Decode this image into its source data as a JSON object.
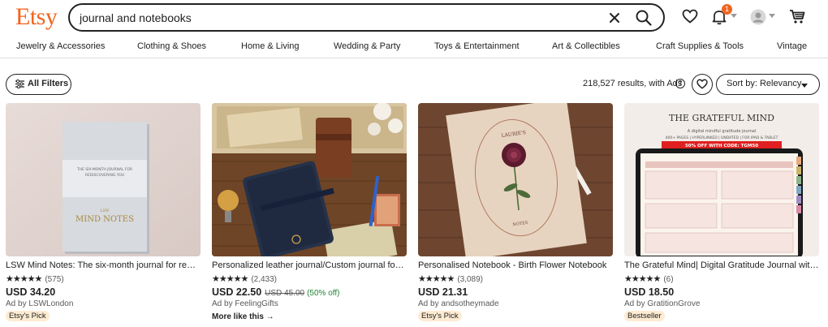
{
  "header": {
    "logo": "Etsy",
    "search_value": "journal and notebooks",
    "notification_count": "1"
  },
  "categories": [
    "Jewelry & Accessories",
    "Clothing & Shoes",
    "Home & Living",
    "Wedding & Party",
    "Toys & Entertainment",
    "Art & Collectibles",
    "Craft Supplies & Tools",
    "Vintage"
  ],
  "toolbar": {
    "filters_label": "All Filters",
    "results_text": "218,527 results, with Ads",
    "sort_label": "Sort by: Relevancy"
  },
  "products": [
    {
      "title": "LSW Mind Notes: The six-month journal for rediscovering you",
      "stars": "★★★★★",
      "reviews": "(575)",
      "price": "USD 34.20",
      "original_price": "",
      "discount": "",
      "seller": "Ad by LSWLondon",
      "badge": "Etsy's Pick",
      "more": ""
    },
    {
      "title": "Personalized leather journal/Custom journal for men",
      "stars": "★★★★★",
      "reviews": "(2,433)",
      "price": "USD 22.50",
      "original_price": "USD 45.00",
      "discount": "(50% off)",
      "seller": "Ad by FeelingGifts",
      "badge": "",
      "more": "More like this →"
    },
    {
      "title": "Personalised Notebook - Birth Flower Notebook",
      "stars": "★★★★★",
      "reviews": "(3,089)",
      "price": "USD 21.31",
      "original_price": "",
      "discount": "",
      "seller": "Ad by andsotheymade",
      "badge": "Etsy's Pick",
      "more": ""
    },
    {
      "title": "The Grateful Mind| Digital Gratitude Journal with hyperlinks",
      "stars": "★★★★★",
      "reviews": "(6)",
      "price": "USD 18.50",
      "original_price": "",
      "discount": "",
      "seller": "Ad by GratitionGrove",
      "badge": "Bestseller",
      "more": ""
    }
  ],
  "images": {
    "p1": {
      "cover_line1": "THE SIX-MONTH JOURNAL FOR",
      "cover_line2": "REDISCOVERING YOU",
      "cover_brand": "LSW",
      "cover_title": "MIND NOTES"
    },
    "p3": {
      "cover_top": "LAURIE'S",
      "cover_bottom": "NOTES"
    },
    "p4": {
      "heading": "THE GRATEFUL MIND",
      "sub": "A digital mindful gratitude journal",
      "sub2": "400+ PAGES | HYPERLINKED | UNDATED | FOR IPAD & TABLET",
      "promo": "50% OFF WITH CODE: TGM50"
    }
  },
  "colors": {
    "brand": "#f1641e",
    "discount": "#258635",
    "badge_bg": "#fdebd2"
  }
}
